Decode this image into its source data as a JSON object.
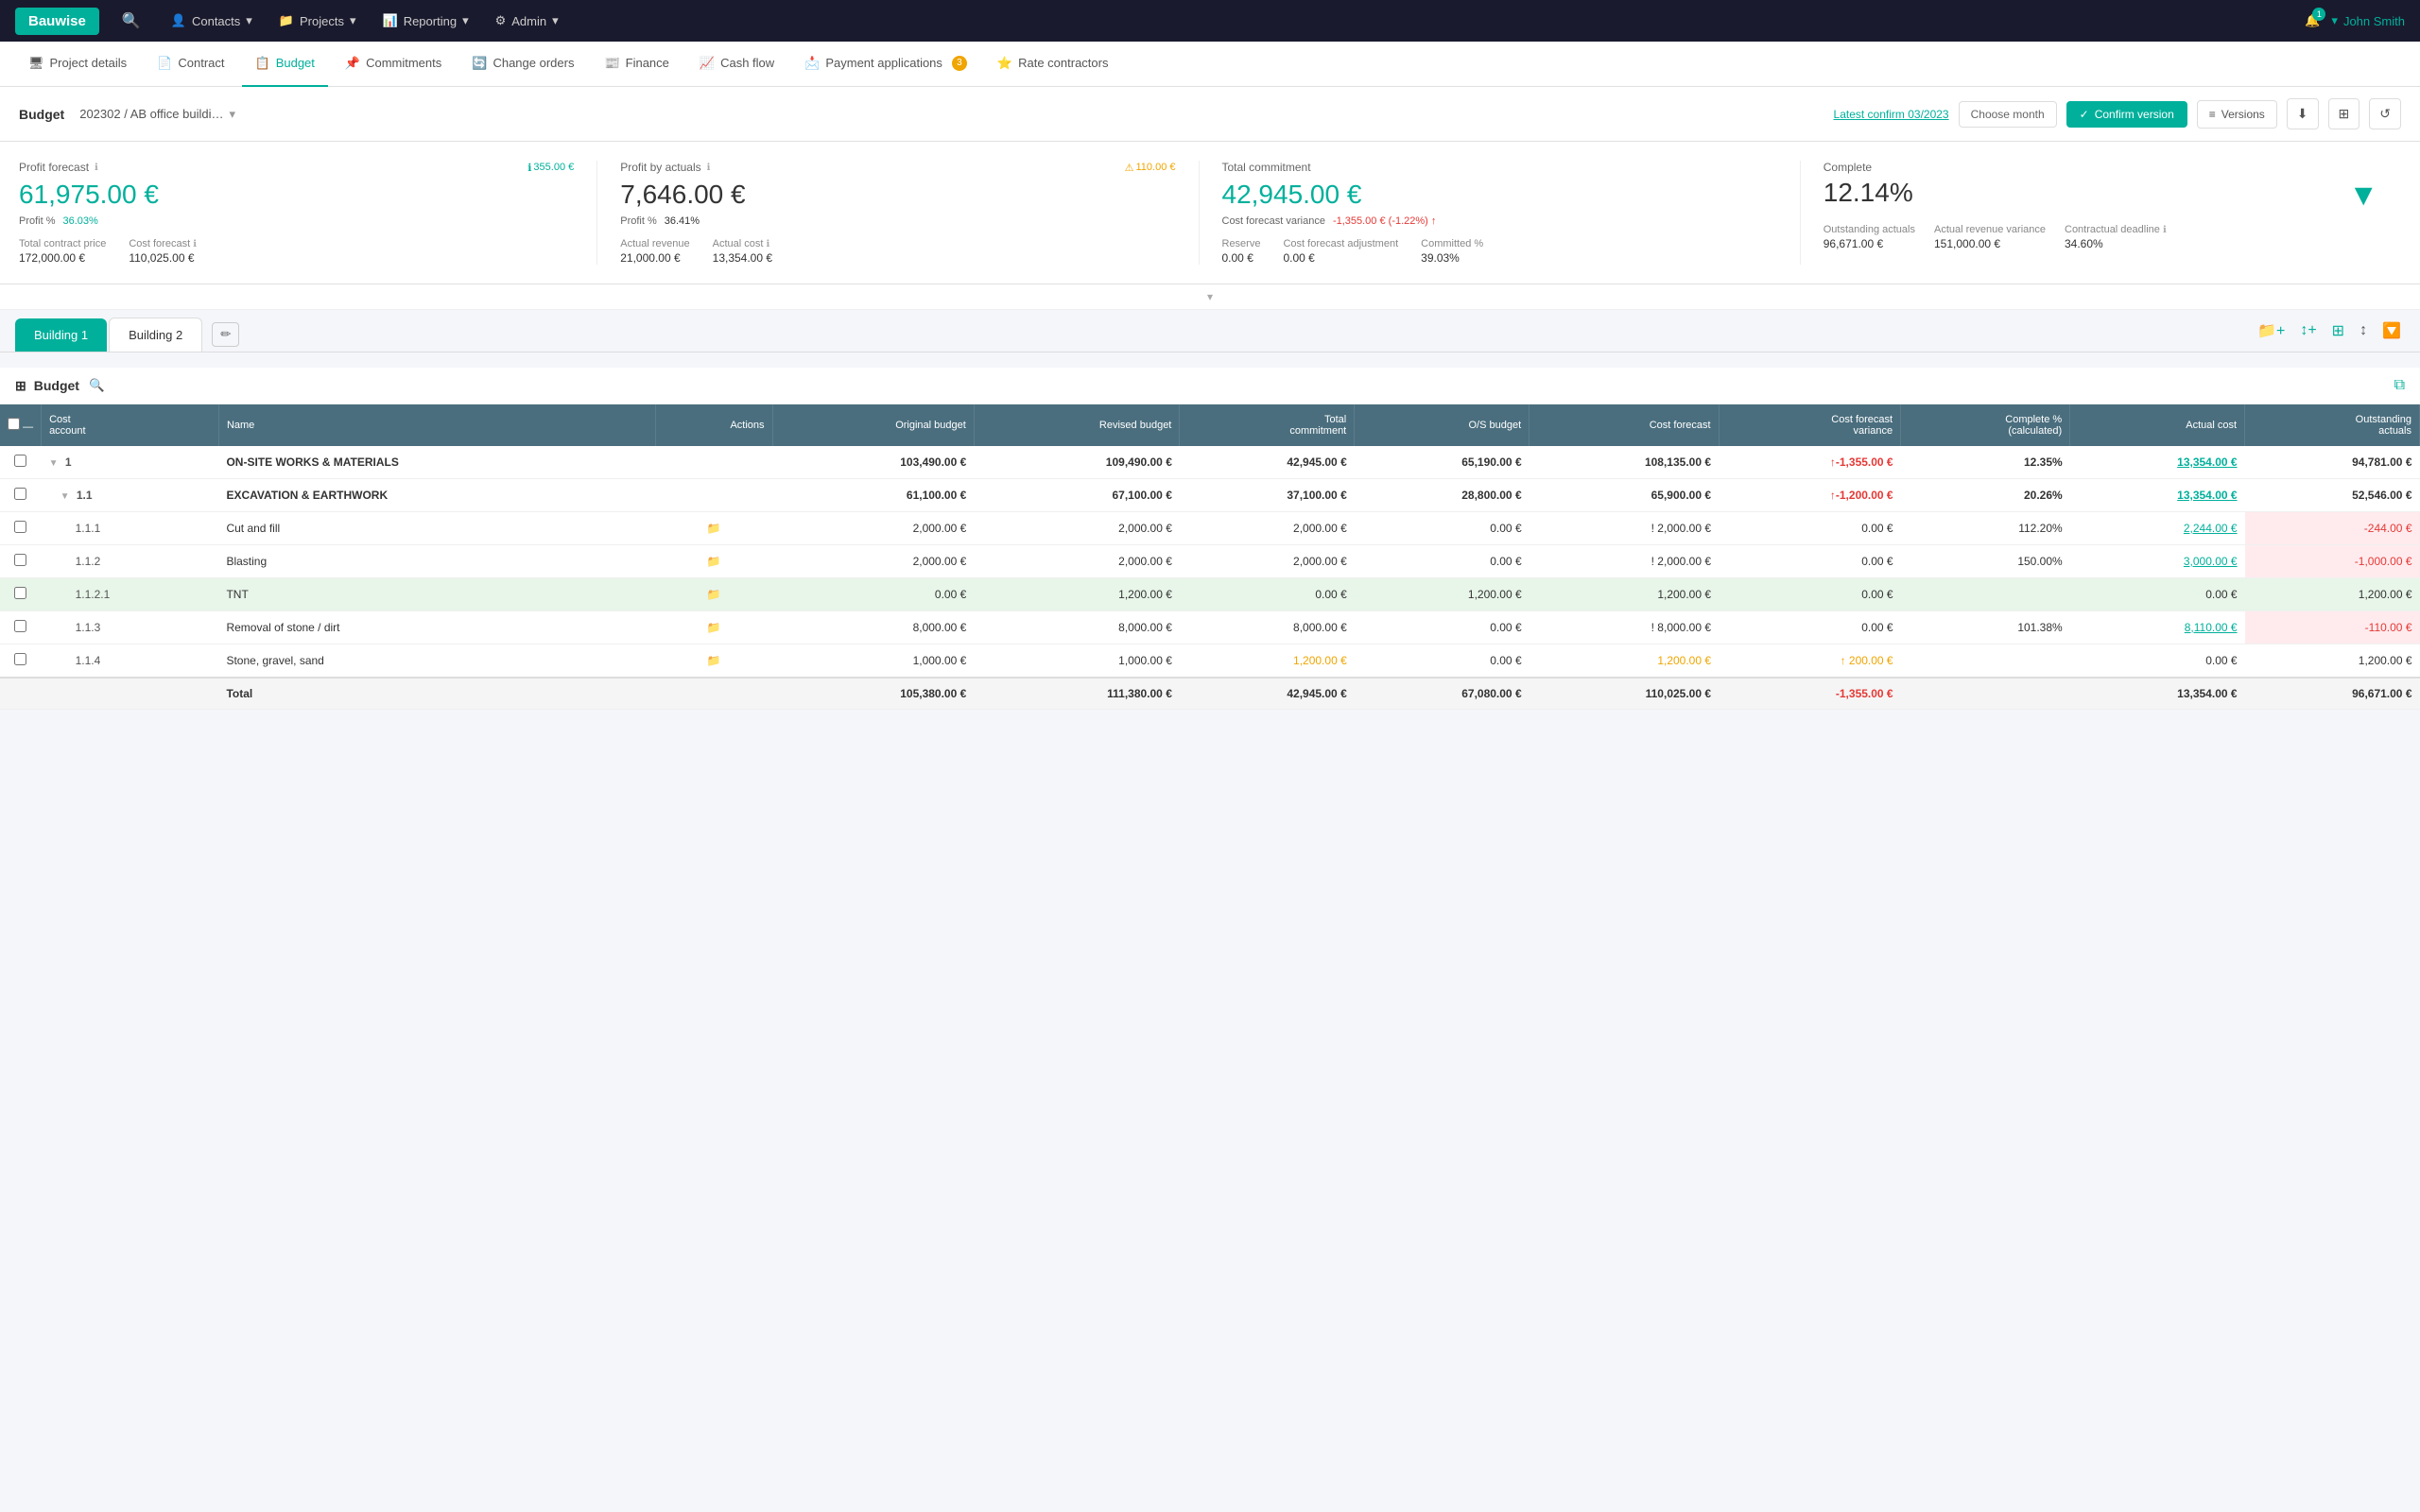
{
  "brand": "Bauwise",
  "topNav": {
    "search_icon": "🔍",
    "items": [
      {
        "label": "Contacts",
        "icon": "👤"
      },
      {
        "label": "Projects",
        "icon": "📁"
      },
      {
        "label": "Reporting",
        "icon": "📊"
      },
      {
        "label": "Admin",
        "icon": "⚙"
      }
    ],
    "bell_count": "1",
    "user": "John Smith"
  },
  "subNav": {
    "items": [
      {
        "label": "Project details",
        "icon": "🖥",
        "active": false
      },
      {
        "label": "Contract",
        "icon": "📄",
        "active": false
      },
      {
        "label": "Budget",
        "icon": "📋",
        "active": true
      },
      {
        "label": "Commitments",
        "icon": "📌",
        "active": false
      },
      {
        "label": "Change orders",
        "icon": "🔄",
        "active": false
      },
      {
        "label": "Finance",
        "icon": "📰",
        "active": false
      },
      {
        "label": "Cash flow",
        "icon": "📈",
        "active": false
      },
      {
        "label": "Payment applications",
        "icon": "📩",
        "active": false,
        "badge": "3"
      },
      {
        "label": "Rate contractors",
        "icon": "⭐",
        "active": false
      }
    ]
  },
  "budgetHeader": {
    "title": "Budget",
    "breadcrumb": "202302 / AB office buildi…",
    "latest_confirm": "Latest confirm 03/2023",
    "choose_month_placeholder": "Choose month",
    "confirm_version_label": "Confirm version",
    "versions_label": "Versions"
  },
  "summaryCards": [
    {
      "title": "Profit forecast",
      "badge": "355.00 €",
      "badge_type": "teal",
      "main_value": "61,975.00 €",
      "sub_label": "Profit %",
      "sub_value": "36.03%",
      "sub_type": "teal",
      "fields": [
        {
          "label": "Total contract price",
          "value": "172,000.00 €"
        },
        {
          "label": "Cost forecast",
          "value": "110,025.00 €"
        }
      ]
    },
    {
      "title": "Profit by actuals",
      "badge": "110.00 €",
      "badge_type": "orange",
      "main_value": "7,646.00 €",
      "sub_label": "Profit %",
      "sub_value": "36.41%",
      "sub_type": "black",
      "fields": [
        {
          "label": "Actual revenue",
          "value": "21,000.00 €"
        },
        {
          "label": "Actual cost",
          "value": "13,354.00 €"
        }
      ]
    },
    {
      "title": "Total commitment",
      "main_value": "42,945.00 €",
      "variance_label": "Cost forecast variance",
      "variance_value": "-1,355.00 €",
      "variance_pct": "(-1.22%)",
      "fields": [
        {
          "label": "Reserve",
          "value": "0.00 €"
        },
        {
          "label": "Cost forecast adjustment",
          "value": "0.00 €"
        },
        {
          "label": "Committed %",
          "value": "39.03%"
        }
      ]
    },
    {
      "title": "Complete",
      "main_value": "12.14%",
      "fields": [
        {
          "label": "Outstanding actuals",
          "value": "96,671.00 €"
        },
        {
          "label": "Actual revenue variance",
          "value": "151,000.00 €"
        },
        {
          "label": "Contractual deadline",
          "value": "34.60%"
        }
      ]
    }
  ],
  "tabs": [
    {
      "label": "Building 1",
      "active": true
    },
    {
      "label": "Building 2",
      "active": false
    }
  ],
  "tableSection": {
    "title": "Budget",
    "columns": [
      {
        "key": "cost_account",
        "label": "Cost account"
      },
      {
        "key": "name",
        "label": "Name"
      },
      {
        "key": "actions",
        "label": "Actions"
      },
      {
        "key": "original_budget",
        "label": "Original budget"
      },
      {
        "key": "revised_budget",
        "label": "Revised budget"
      },
      {
        "key": "total_commitment",
        "label": "Total commitment"
      },
      {
        "key": "os_budget",
        "label": "O/S budget"
      },
      {
        "key": "cost_forecast",
        "label": "Cost forecast"
      },
      {
        "key": "cost_forecast_variance",
        "label": "Cost forecast variance"
      },
      {
        "key": "complete_pct",
        "label": "Complete % (calculated)"
      },
      {
        "key": "actual_cost",
        "label": "Actual cost"
      },
      {
        "key": "outstanding_actuals",
        "label": "Outstanding actuals"
      }
    ],
    "rows": [
      {
        "id": "1",
        "type": "group",
        "cost_account": "1",
        "name": "ON-SITE WORKS & MATERIALS",
        "original_budget": "103,490.00 €",
        "revised_budget": "109,490.00 €",
        "total_commitment": "42,945.00 €",
        "os_budget": "65,190.00 €",
        "cost_forecast": "108,135.00 €",
        "cost_forecast_variance": "↑-1,355.00 €",
        "complete_pct": "12.35%",
        "actual_cost": "13,354.00 €",
        "outstanding_actuals": "94,781.00 €",
        "actual_cost_link": true,
        "variance_class": "red"
      },
      {
        "id": "1.1",
        "type": "subgroup",
        "cost_account": "1.1",
        "name": "EXCAVATION & EARTHWORK",
        "original_budget": "61,100.00 €",
        "revised_budget": "67,100.00 €",
        "total_commitment": "37,100.00 €",
        "os_budget": "28,800.00 €",
        "cost_forecast": "65,900.00 €",
        "cost_forecast_variance": "↑-1,200.00 €",
        "complete_pct": "20.26%",
        "actual_cost": "13,354.00 €",
        "outstanding_actuals": "52,546.00 €",
        "actual_cost_link": true,
        "variance_class": "red"
      },
      {
        "id": "1.1.1",
        "type": "item",
        "cost_account": "1.1.1",
        "name": "Cut and fill",
        "original_budget": "2,000.00 €",
        "revised_budget": "2,000.00 €",
        "total_commitment": "2,000.00 €",
        "os_budget": "0.00 €",
        "cost_forecast": "! 2,000.00 €",
        "cost_forecast_variance": "0.00 €",
        "complete_pct": "112.20%",
        "actual_cost": "2,244.00 €",
        "outstanding_actuals": "-244.00 €",
        "actual_cost_link": true,
        "outstanding_class": "red_bg"
      },
      {
        "id": "1.1.2",
        "type": "item",
        "cost_account": "1.1.2",
        "name": "Blasting",
        "original_budget": "2,000.00 €",
        "revised_budget": "2,000.00 €",
        "total_commitment": "2,000.00 €",
        "os_budget": "0.00 €",
        "cost_forecast": "! 2,000.00 €",
        "cost_forecast_variance": "0.00 €",
        "complete_pct": "150.00%",
        "actual_cost": "3,000.00 €",
        "outstanding_actuals": "-1,000.00 €",
        "actual_cost_link": true,
        "outstanding_class": "red_bg"
      },
      {
        "id": "1.1.2.1",
        "type": "subitem",
        "cost_account": "1.1.2.1",
        "name": "TNT",
        "original_budget": "0.00 €",
        "revised_budget": "1,200.00 €",
        "total_commitment": "0.00 €",
        "os_budget": "1,200.00 €",
        "cost_forecast": "1,200.00 €",
        "cost_forecast_variance": "0.00 €",
        "complete_pct": "",
        "actual_cost": "0.00 €",
        "outstanding_actuals": "1,200.00 €",
        "row_class": "green_bg"
      },
      {
        "id": "1.1.3",
        "type": "item",
        "cost_account": "1.1.3",
        "name": "Removal of stone / dirt",
        "original_budget": "8,000.00 €",
        "revised_budget": "8,000.00 €",
        "total_commitment": "8,000.00 €",
        "os_budget": "0.00 €",
        "cost_forecast": "! 8,000.00 €",
        "cost_forecast_variance": "0.00 €",
        "complete_pct": "101.38%",
        "actual_cost": "8,110.00 €",
        "outstanding_actuals": "-110.00 €",
        "actual_cost_link": true,
        "outstanding_class": "red_bg"
      },
      {
        "id": "1.1.4",
        "type": "item",
        "cost_account": "1.1.4",
        "name": "Stone, gravel, sand",
        "original_budget": "1,000.00 €",
        "revised_budget": "1,000.00 €",
        "total_commitment": "1,200.00 €",
        "os_budget": "0.00 €",
        "cost_forecast": "1,200.00 €",
        "cost_forecast_variance": "↑ 200.00 €",
        "complete_pct": "",
        "actual_cost": "0.00 €",
        "outstanding_actuals": "1,200.00 €",
        "cost_forecast_class": "orange",
        "variance_class": "orange"
      }
    ],
    "total_row": {
      "label": "Total",
      "original_budget": "105,380.00 €",
      "revised_budget": "111,380.00 €",
      "total_commitment": "42,945.00 €",
      "os_budget": "67,080.00 €",
      "cost_forecast": "110,025.00 €",
      "cost_forecast_variance": "-1,355.00 €",
      "complete_pct": "",
      "actual_cost": "13,354.00 €",
      "outstanding_actuals": "96,671.00 €"
    }
  }
}
